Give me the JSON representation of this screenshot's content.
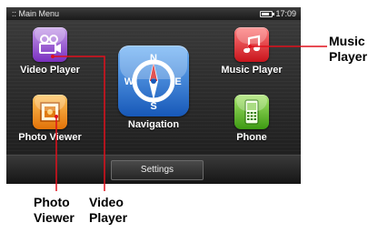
{
  "status_bar": {
    "title": ":: Main Menu",
    "time": "17:09"
  },
  "apps": {
    "video_player": {
      "label": "Video Player",
      "icon": "film-camera-icon"
    },
    "photo_viewer": {
      "label": "Photo Viewer",
      "icon": "photo-frame-icon"
    },
    "navigation": {
      "label": "Navigation",
      "icon": "compass-icon",
      "directions": {
        "n": "N",
        "s": "S",
        "e": "E",
        "w": "W"
      }
    },
    "music_player": {
      "label": "Music Player",
      "icon": "music-note-icon"
    },
    "phone": {
      "label": "Phone",
      "icon": "mobile-phone-icon"
    }
  },
  "bottom_bar": {
    "settings_label": "Settings"
  },
  "callouts": {
    "music_player": [
      "Music",
      "Player"
    ],
    "photo_viewer": [
      "Photo",
      "Viewer"
    ],
    "video_player": [
      "Video",
      "Player"
    ]
  },
  "colors": {
    "video_tile": "#9a58d6",
    "photo_tile": "#f59a22",
    "music_tile": "#e83a3a",
    "phone_tile": "#6cc23a",
    "nav_tile": "#3f86dd",
    "leader_line": "#e0101c"
  }
}
